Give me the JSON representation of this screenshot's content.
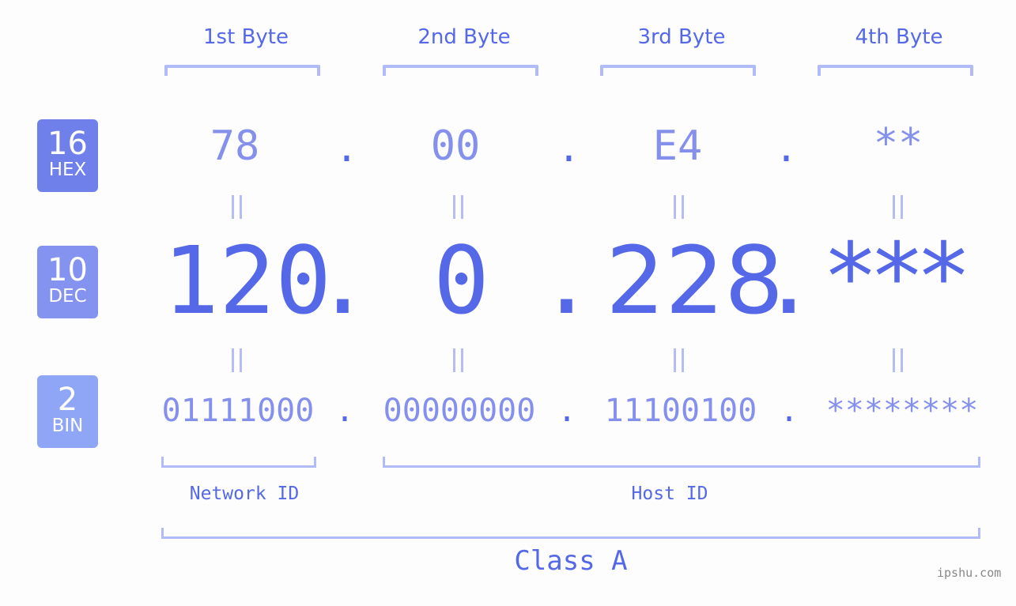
{
  "header": {
    "bytes": [
      "1st Byte",
      "2nd Byte",
      "3rd Byte",
      "4th Byte"
    ]
  },
  "bases": [
    {
      "number": "16",
      "label": "HEX",
      "color": "#7080ea"
    },
    {
      "number": "10",
      "label": "DEC",
      "color": "#8593f0"
    },
    {
      "number": "2",
      "label": "BIN",
      "color": "#8fa6f7"
    }
  ],
  "hex": {
    "octets": [
      "78",
      "00",
      "E4",
      "**"
    ],
    "separator": "."
  },
  "dec": {
    "octets": [
      "120",
      "0",
      "228",
      "***"
    ],
    "separator": "."
  },
  "bin": {
    "octets": [
      "01111000",
      "00000000",
      "11100100",
      "********"
    ],
    "separator": "."
  },
  "segments": {
    "network_id": "Network ID",
    "host_id": "Host ID",
    "class": "Class A"
  },
  "colors": {
    "accent": "#5468e8",
    "light": "#8590ed",
    "bracket": "#b1bbf8"
  },
  "brand": "ipshu.com"
}
